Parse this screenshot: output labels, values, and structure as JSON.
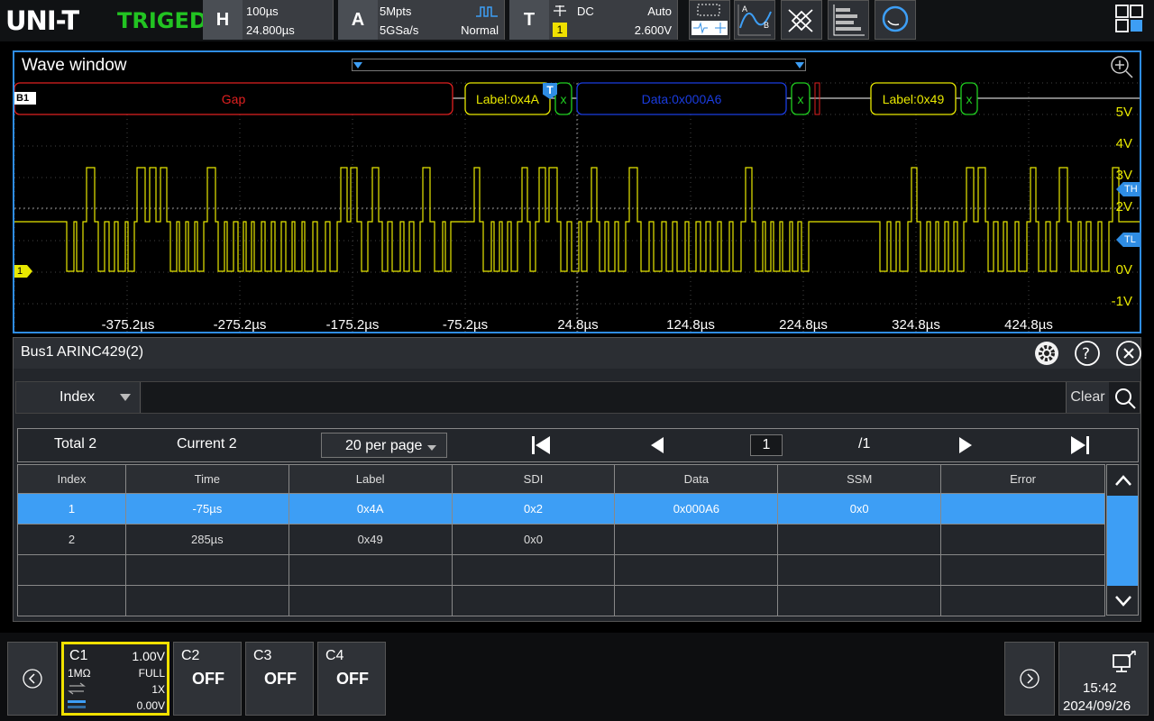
{
  "brand": {
    "logo": "UNI-T",
    "status": "TRIGED"
  },
  "horizontal": {
    "key": "H",
    "timebase": "100µs",
    "offset": "24.800µs"
  },
  "acquire": {
    "key": "A",
    "depth": "5Mpts",
    "rate": "5GSa/s",
    "mode": "Normal"
  },
  "trigger": {
    "key": "T",
    "coupling": "DC",
    "sweep": "Auto",
    "source": "1",
    "level": "2.600V"
  },
  "wave": {
    "title": "Wave window",
    "bus_label": "B1",
    "ch_marker": "1",
    "trig_marker": "T",
    "th_high": "TH",
    "th_low": "TL",
    "segments": [
      {
        "text": "Gap",
        "color": "#e02020"
      },
      {
        "text": "Label:0x4A",
        "color": "#e8e800"
      },
      {
        "text": "x",
        "color": "#20d020"
      },
      {
        "text": "Data:0x000A6",
        "color": "#1a3ce0"
      },
      {
        "text": "x",
        "color": "#20d020"
      },
      {
        "text": "Label:0x49",
        "color": "#e8e800"
      },
      {
        "text": "x",
        "color": "#20d020"
      }
    ],
    "volts": [
      "5V",
      "4V",
      "3V",
      "2V",
      "0V",
      "-1V"
    ],
    "times": [
      "-375.2µs",
      "-275.2µs",
      "-175.2µs",
      "-75.2µs",
      "24.8µs",
      "124.8µs",
      "224.8µs",
      "324.8µs",
      "424.8µs"
    ]
  },
  "bus": {
    "title": "Bus1 ARINC429(2)",
    "filter_field": "Index",
    "clear_label": "Clear",
    "total": "Total 2",
    "current": "Current 2",
    "per_page": "20 per page",
    "page": "1",
    "pages": "/1",
    "columns": [
      "Index",
      "Time",
      "Label",
      "SDI",
      "Data",
      "SSM",
      "Error"
    ],
    "rows": [
      [
        "1",
        "-75µs",
        "0x4A",
        "0x2",
        "0x000A6",
        "0x0",
        ""
      ],
      [
        "2",
        "285µs",
        "0x49",
        "0x0",
        "",
        "",
        ""
      ],
      [
        "",
        "",
        "",
        "",
        "",
        "",
        ""
      ],
      [
        "",
        "",
        "",
        "",
        "",
        "",
        ""
      ]
    ]
  },
  "channels": {
    "c1": {
      "name": "C1",
      "scale": "1.00V",
      "imp": "1MΩ",
      "bw": "FULL",
      "probe": "1X",
      "offset": "0.00V"
    },
    "c2": {
      "name": "C2",
      "state": "OFF"
    },
    "c3": {
      "name": "C3",
      "state": "OFF"
    },
    "c4": {
      "name": "C4",
      "state": "OFF"
    }
  },
  "clock": {
    "time": "15:42",
    "date": "2024/09/26"
  }
}
